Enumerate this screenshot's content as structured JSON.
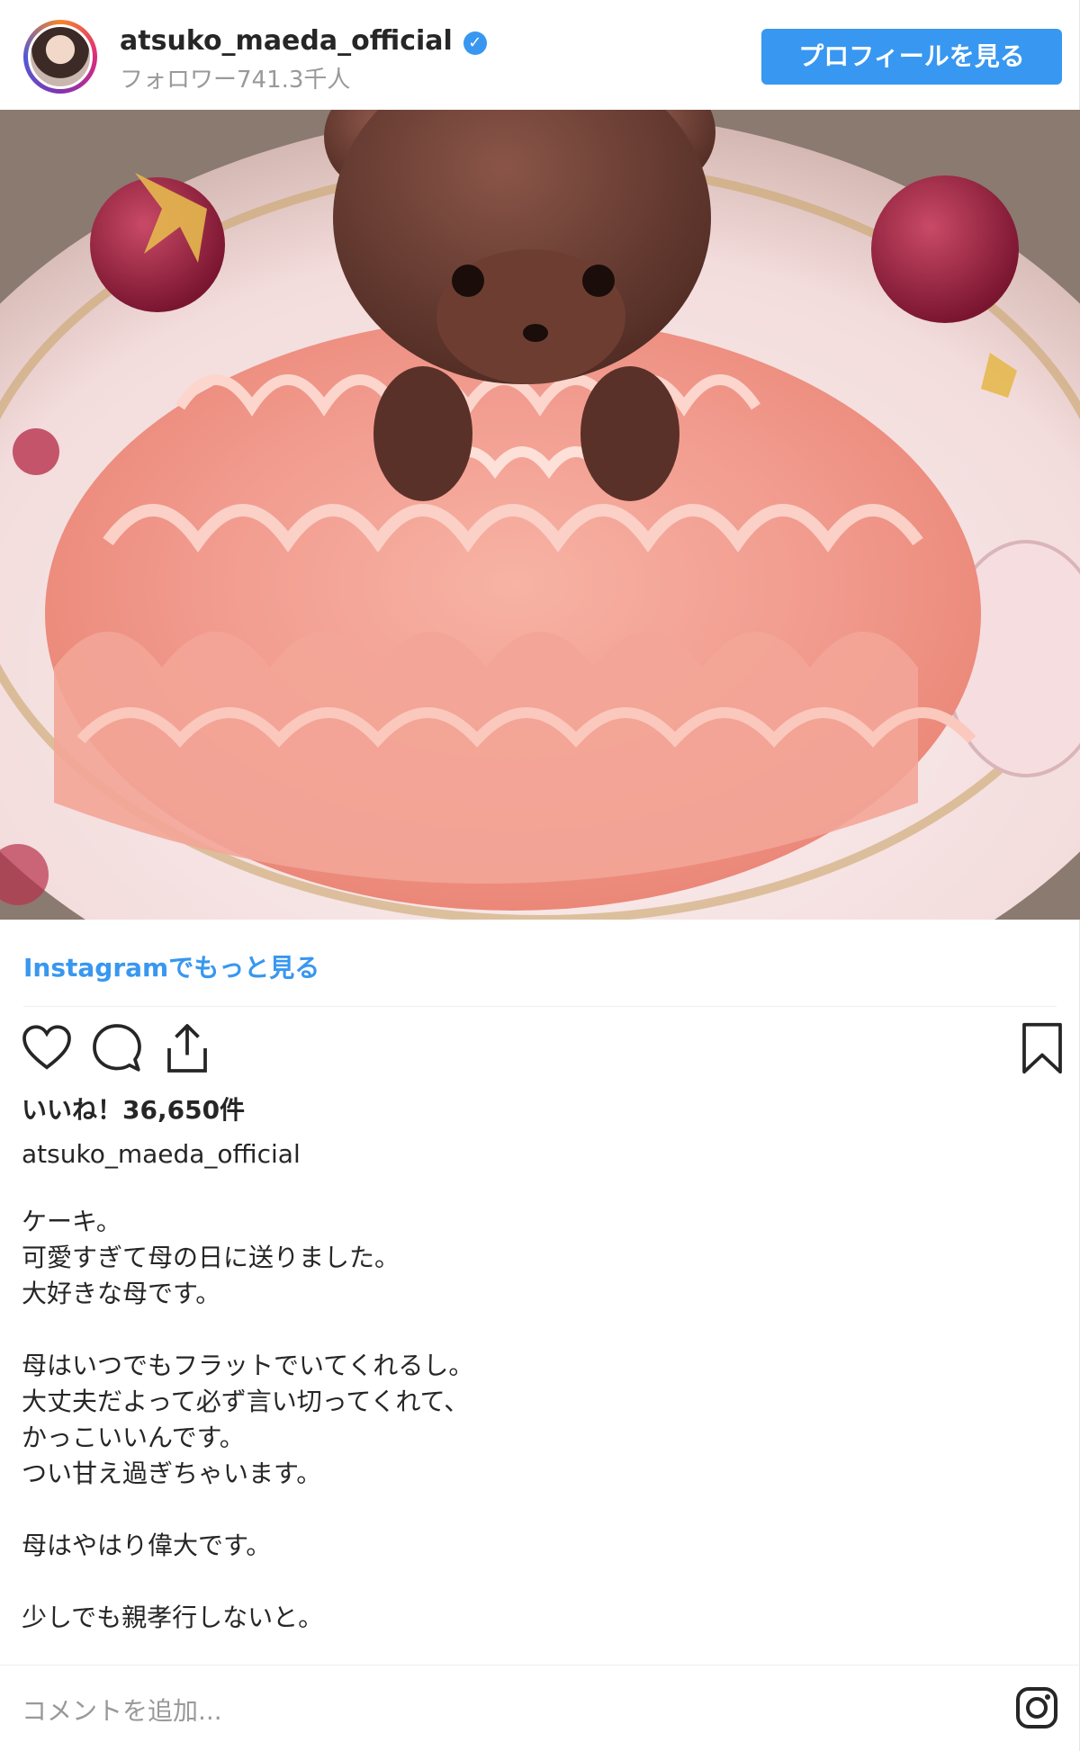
{
  "header": {
    "username": "atsuko_maeda_official",
    "verified_icon": "verified-badge-icon",
    "followers": "フォロワー741.3千人",
    "profile_button": "プロフィールを見る"
  },
  "post": {
    "more_link": "Instagramでもっと見る",
    "likes": "いいね！36,650件",
    "caption_user": "atsuko_maeda_official",
    "caption_lines": [
      "ケーキ。",
      "可愛すぎて母の日に送りました。",
      "大好きな母です。",
      "",
      "母はいつでもフラットでいてくれるし。",
      "大丈夫だよって必ず言い切ってくれて、",
      "かっこいいんです。",
      "つい甘え過ぎちゃいます。",
      "",
      "母はやはり偉大です。",
      "",
      "少しでも親孝行しないと。"
    ]
  },
  "comment": {
    "placeholder": "コメントを追加..."
  },
  "colors": {
    "accent": "#3897f0",
    "text": "#262626",
    "muted": "#999999"
  },
  "icons": [
    "heart-icon",
    "comment-icon",
    "share-icon",
    "bookmark-icon",
    "instagram-icon"
  ]
}
